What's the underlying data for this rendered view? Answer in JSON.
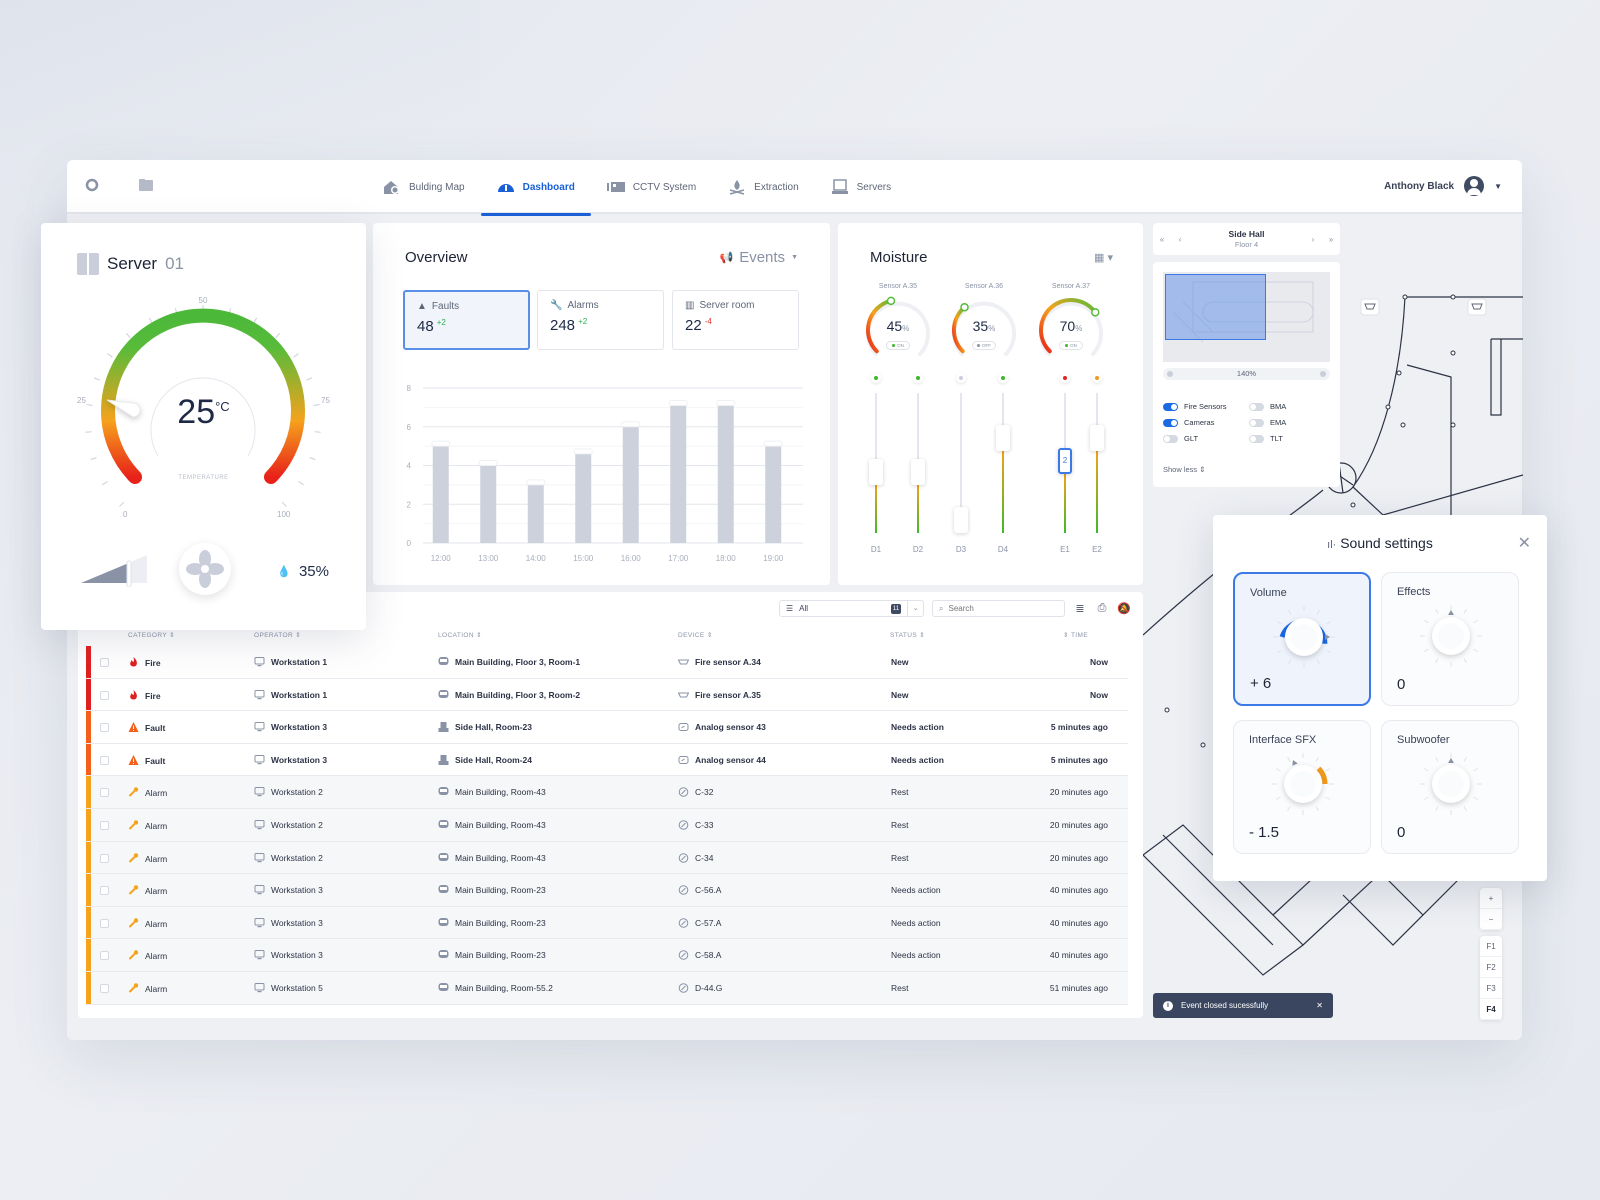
{
  "topbar": {
    "nav": [
      {
        "label": "Bulding Map",
        "icon": "building-map-icon",
        "active": false
      },
      {
        "label": "Dashboard",
        "icon": "dashboard-gauge-icon",
        "active": true
      },
      {
        "label": "CCTV System",
        "icon": "cctv-icon",
        "active": false
      },
      {
        "label": "Extraction",
        "icon": "extraction-icon",
        "active": false
      },
      {
        "label": "Servers",
        "icon": "servers-icon",
        "active": false
      }
    ],
    "user": "Anthony Black"
  },
  "server": {
    "title": "Server",
    "number": "01",
    "temperature": "25",
    "unit": "°C",
    "temp_label": "TEMPERATURE",
    "scale": [
      "0",
      "25",
      "50",
      "75",
      "100"
    ],
    "gauge_min": 0,
    "gauge_max": 100,
    "current": 25,
    "humidity": "35%",
    "fan_level": 0.7
  },
  "overview": {
    "title": "Overview",
    "events_label": "Events",
    "stats": [
      {
        "label": "Faults",
        "value": "48",
        "delta": "+2",
        "trend": "up",
        "icon": "warning-icon"
      },
      {
        "label": "Alarms",
        "value": "248",
        "delta": "+2",
        "trend": "up",
        "icon": "wrench-icon"
      },
      {
        "label": "Server room",
        "value": "22",
        "delta": "-4",
        "trend": "down",
        "icon": "server-icon"
      }
    ]
  },
  "chart_data": {
    "type": "bar",
    "categories": [
      "12:00",
      "13:00",
      "14:00",
      "15:00",
      "16:00",
      "17:00",
      "18:00",
      "19:00"
    ],
    "values": [
      5,
      4,
      3,
      4.6,
      6,
      7.1,
      7.1,
      5
    ],
    "title": "",
    "xlabel": "",
    "ylabel": "",
    "ylim": [
      0,
      8
    ],
    "yticks": [
      "0",
      "2",
      "4",
      "6",
      "8"
    ],
    "grid": true
  },
  "moisture": {
    "title": "Moisture",
    "sensors": [
      {
        "name": "Sensor A.35",
        "value": 45,
        "state": "ON"
      },
      {
        "name": "Sensor A.36",
        "value": 35,
        "state": "OFF"
      },
      {
        "name": "Sensor A.37",
        "value": 70,
        "state": "ON"
      }
    ],
    "sliders": [
      {
        "label": "D1",
        "level": 0.42,
        "status": "#3cb82a"
      },
      {
        "label": "D2",
        "level": 0.42,
        "status": "#3cb82a"
      },
      {
        "label": "D3",
        "level": 0.0,
        "status": "#c9ceda"
      },
      {
        "label": "D4",
        "level": 0.72,
        "status": "#3cb82a"
      },
      {
        "label": "E1",
        "level": 0.52,
        "status": "#e52222",
        "selected": true,
        "value": "2"
      },
      {
        "label": "E2",
        "level": 0.72,
        "status": "#f29a1a"
      }
    ]
  },
  "table": {
    "filter": "All",
    "filter_count": "11",
    "search_placeholder": "Search",
    "headers": [
      "CATEGORY",
      "OPERATOR",
      "LOCATION",
      "DEVICE",
      "STATUS",
      "TIME"
    ],
    "rows": [
      {
        "category": "Fire",
        "operator": "Workstation 1",
        "location": "Main Building, Floor 3, Room-1",
        "device": "Fire sensor A.34",
        "status": "New",
        "time": "Now",
        "color": "#e02020",
        "bold": true
      },
      {
        "category": "Fire",
        "operator": "Workstation 1",
        "location": "Main Building, Floor 3, Room-2",
        "device": "Fire sensor A.35",
        "status": "New",
        "time": "Now",
        "color": "#e02020",
        "bold": true
      },
      {
        "category": "Fault",
        "operator": "Workstation 3",
        "location": "Side Hall, Room-23",
        "device": "Analog sensor 43",
        "status": "Needs action",
        "time": "5 minutes ago",
        "color": "#f2601a",
        "bold": true
      },
      {
        "category": "Fault",
        "operator": "Workstation 3",
        "location": "Side Hall, Room-24",
        "device": "Analog sensor 44",
        "status": "Needs action",
        "time": "5 minutes ago",
        "color": "#f2601a",
        "bold": true
      },
      {
        "category": "Alarm",
        "operator": "Workstation 2",
        "location": "Main Building, Room-43",
        "device": "C-32",
        "status": "Rest",
        "time": "20 minutes ago",
        "color": "#f5a21c",
        "bold": false
      },
      {
        "category": "Alarm",
        "operator": "Workstation 2",
        "location": "Main Building, Room-43",
        "device": "C-33",
        "status": "Rest",
        "time": "20 minutes ago",
        "color": "#f5a21c",
        "bold": false
      },
      {
        "category": "Alarm",
        "operator": "Workstation 2",
        "location": "Main Building, Room-43",
        "device": "C-34",
        "status": "Rest",
        "time": "20 minutes ago",
        "color": "#f5a21c",
        "bold": false
      },
      {
        "category": "Alarm",
        "operator": "Workstation 3",
        "location": "Main Building, Room-23",
        "device": "C-56.A",
        "status": "Needs action",
        "time": "40 minutes ago",
        "color": "#f5a21c",
        "bold": false
      },
      {
        "category": "Alarm",
        "operator": "Workstation 3",
        "location": "Main Building, Room-23",
        "device": "C-57.A",
        "status": "Needs action",
        "time": "40 minutes ago",
        "color": "#f5a21c",
        "bold": false
      },
      {
        "category": "Alarm",
        "operator": "Workstation 3",
        "location": "Main Building, Room-23",
        "device": "C-58.A",
        "status": "Needs action",
        "time": "40 minutes ago",
        "color": "#f5a21c",
        "bold": false
      },
      {
        "category": "Alarm",
        "operator": "Workstation 5",
        "location": "Main Building, Room-55.2",
        "device": "D-44.G",
        "status": "Rest",
        "time": "51 minutes ago",
        "color": "#f5a21c",
        "bold": false
      }
    ]
  },
  "map": {
    "building": "Side Hall",
    "floor": "Floor 4",
    "zoom": "140%",
    "toggles": [
      {
        "label": "Fire Sensors",
        "on": true
      },
      {
        "label": "BMA",
        "on": false
      },
      {
        "label": "Cameras",
        "on": true
      },
      {
        "label": "EMA",
        "on": false
      },
      {
        "label": "GLT",
        "on": false
      },
      {
        "label": "TLT",
        "on": false
      }
    ],
    "show_less": "Show less",
    "floors": [
      "F1",
      "F2",
      "F3",
      "F4"
    ],
    "active_floor": "F4"
  },
  "sound": {
    "title": "Sound settings",
    "knobs": [
      {
        "label": "Volume",
        "value": "+ 6",
        "level": 6,
        "color": "#1a6ae6",
        "selected": true
      },
      {
        "label": "Effects",
        "value": "0",
        "level": 0,
        "color": "",
        "selected": false
      },
      {
        "label": "Interface SFX",
        "value": "- 1.5",
        "level": -1.5,
        "color": "#f29a1a",
        "selected": false
      },
      {
        "label": "Subwoofer",
        "value": "0",
        "level": 0,
        "color": "",
        "selected": false
      }
    ]
  },
  "toast": {
    "message": "Event closed sucessfully"
  }
}
